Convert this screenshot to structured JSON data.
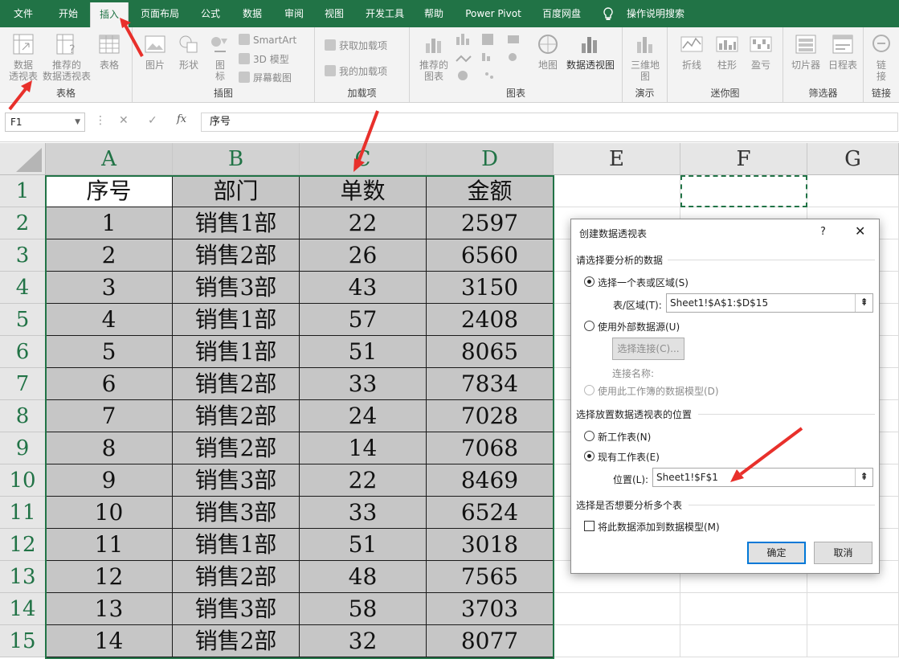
{
  "tabs": [
    "文件",
    "开始",
    "插入",
    "页面布局",
    "公式",
    "数据",
    "审阅",
    "视图",
    "开发工具",
    "帮助",
    "Power Pivot",
    "百度网盘",
    "操作说明搜索"
  ],
  "ribbon": {
    "groups": [
      "表格",
      "插图",
      "加载项",
      "图表",
      "演示",
      "迷你图",
      "筛选器",
      "链接"
    ],
    "table": {
      "pivot": "数据\n透视表",
      "recommended": "推荐的\n数据透视表",
      "table": "表格"
    },
    "illustrations": {
      "picture": "图片",
      "shapes": "形状",
      "icons": "图\n标",
      "smartart": "SmartArt",
      "model3d": "3D 模型",
      "screenshot": "屏幕截图"
    },
    "addins": {
      "get": "获取加载项",
      "my": "我的加载项"
    },
    "charts": {
      "recommended": "推荐的\n图表",
      "map": "地图",
      "pivotchart": "数据透视图"
    },
    "tours": {
      "map3d": "三维地\n图"
    },
    "sparklines": {
      "line": "折线",
      "column": "柱形",
      "winloss": "盈亏"
    },
    "filters": {
      "slicer": "切片器",
      "timeline": "日程表"
    },
    "links": {
      "link": "链\n接"
    }
  },
  "formula_bar": {
    "namebox": "F1",
    "fx": "fx",
    "value": "序号"
  },
  "sheet": {
    "columns": [
      "A",
      "B",
      "C",
      "D",
      "E",
      "F",
      "G"
    ],
    "rows": [
      "1",
      "2",
      "3",
      "4",
      "5",
      "6",
      "7",
      "8",
      "9",
      "10",
      "11",
      "12",
      "13",
      "14",
      "15"
    ],
    "header": [
      "序号",
      "部门",
      "单数",
      "金额"
    ],
    "data": [
      [
        "1",
        "销售1部",
        "22",
        "2597"
      ],
      [
        "2",
        "销售2部",
        "26",
        "6560"
      ],
      [
        "3",
        "销售3部",
        "43",
        "3150"
      ],
      [
        "4",
        "销售1部",
        "57",
        "2408"
      ],
      [
        "5",
        "销售1部",
        "51",
        "8065"
      ],
      [
        "6",
        "销售2部",
        "33",
        "7834"
      ],
      [
        "7",
        "销售2部",
        "24",
        "7028"
      ],
      [
        "8",
        "销售2部",
        "14",
        "7068"
      ],
      [
        "9",
        "销售3部",
        "22",
        "8469"
      ],
      [
        "10",
        "销售3部",
        "33",
        "6524"
      ],
      [
        "11",
        "销售1部",
        "51",
        "3018"
      ],
      [
        "12",
        "销售2部",
        "48",
        "7565"
      ],
      [
        "13",
        "销售3部",
        "58",
        "3703"
      ],
      [
        "14",
        "销售2部",
        "32",
        "8077"
      ]
    ]
  },
  "dialog": {
    "title": "创建数据透视表",
    "help": "?",
    "close": "✕",
    "section_choose": "请选择要分析的数据",
    "opt_range": "选择一个表或区域(S)",
    "range_label": "表/区域(T):",
    "range_value": "Sheet1!$A$1:$D$15",
    "opt_external": "使用外部数据源(U)",
    "choose_conn": "选择连接(C)...",
    "conn_name": "连接名称:",
    "opt_model": "使用此工作簿的数据模型(D)",
    "section_location": "选择放置数据透视表的位置",
    "opt_new": "新工作表(N)",
    "opt_existing": "现有工作表(E)",
    "location_label": "位置(L):",
    "location_value": "Sheet1!$F$1",
    "section_multi": "选择是否想要分析多个表",
    "add_model": "将此数据添加到数据模型(M)",
    "ok": "确定",
    "cancel": "取消"
  },
  "colors": {
    "excel_green": "#217346",
    "arrow_red": "#e8302b",
    "selection_grey": "#c6c6c6"
  }
}
